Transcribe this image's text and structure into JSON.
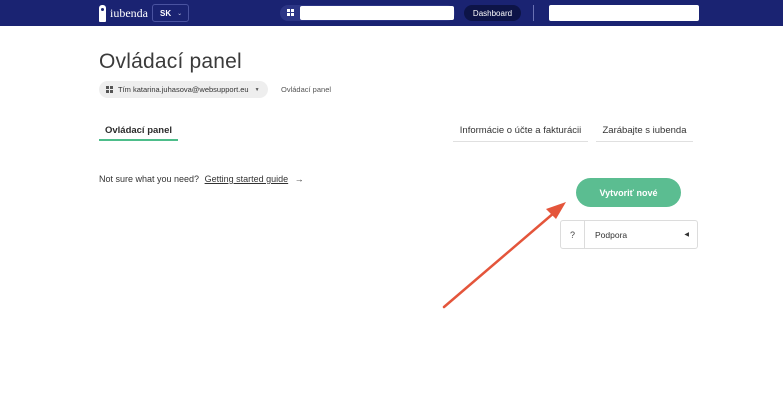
{
  "navbar": {
    "logo_text": "iubenda",
    "language": "SK",
    "dashboard_label": "Dashboard"
  },
  "header": {
    "title": "Ovládací panel",
    "account_chip": "Tím katarina.juhasova@websupport.eu",
    "breadcrumb_current": "Ovládací panel"
  },
  "tabs": [
    {
      "label": "Ovládací panel",
      "active": true
    },
    {
      "label": "Informácie o účte a fakturácii",
      "active": false
    },
    {
      "label": "Zarábajte s iubenda",
      "active": false
    }
  ],
  "guide": {
    "prompt": "Not sure what you need?",
    "link": "Getting started guide",
    "arrow": "→"
  },
  "actions": {
    "create_label": "Vytvoriť nové"
  },
  "support": {
    "icon": "?",
    "label": "Podpora"
  },
  "colors": {
    "navbar_bg": "#1a2372",
    "accent_green": "#5bbd91",
    "annotation_arrow": "#e4553b"
  }
}
